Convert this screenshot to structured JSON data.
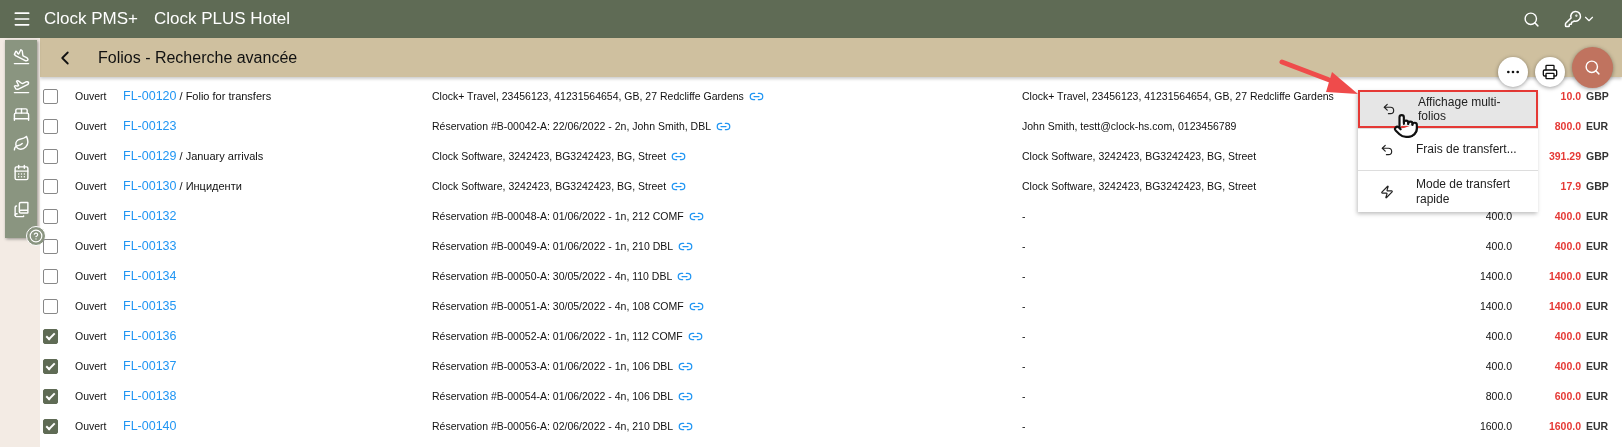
{
  "app_bar": {
    "app_name": "Clock PMS+",
    "hotel_name": "Clock PLUS Hotel"
  },
  "page_header": {
    "title": "Folios - Recherche avancée"
  },
  "rows": [
    {
      "checked": false,
      "status": "Ouvert",
      "folio": "FL-00120",
      "note": "/ Folio for transfers",
      "description": "Clock+ Travel, 23456123, 41231564654, GB, 27 Redcliffe Gardens",
      "client": "Clock+ Travel, 23456123, 41231564654, GB, 27 Redcliffe Gardens",
      "balance": "10.0",
      "currency": "GBP"
    },
    {
      "checked": false,
      "status": "Ouvert",
      "folio": "FL-00123",
      "description": "Réservation #B-00042-A: 22/06/2022 - 2n, John Smith, DBL",
      "client": "John Smith, testt@clock-hs.com, 0123456789",
      "balance": "800.0",
      "currency": "EUR"
    },
    {
      "checked": false,
      "status": "Ouvert",
      "folio": "FL-00129",
      "note": "/ January arrivals",
      "description": "Clock Software, 3242423, BG3242423, BG, Street",
      "client": "Clock Software, 3242423, BG3242423, BG, Street",
      "balance": "391.29",
      "currency": "GBP"
    },
    {
      "checked": false,
      "status": "Ouvert",
      "folio": "FL-00130",
      "note": "/ Инциденти",
      "description": "Clock Software, 3242423, BG3242423, BG, Street",
      "client": "Clock Software, 3242423, BG3242423, BG, Street",
      "balance": "17.9",
      "currency": "GBP"
    },
    {
      "checked": false,
      "status": "Ouvert",
      "folio": "FL-00132",
      "description": "Réservation #B-00048-A: 01/06/2022 - 1n, 212 COMF",
      "client": "-",
      "amount": "400.0",
      "balance": "400.0",
      "currency": "EUR"
    },
    {
      "checked": false,
      "status": "Ouvert",
      "folio": "FL-00133",
      "description": "Réservation #B-00049-A: 01/06/2022 - 1n, 210 DBL",
      "client": "-",
      "amount": "400.0",
      "balance": "400.0",
      "currency": "EUR"
    },
    {
      "checked": false,
      "status": "Ouvert",
      "folio": "FL-00134",
      "description": "Réservation #B-00050-A: 30/05/2022 - 4n, 110 DBL",
      "client": "-",
      "amount": "1400.0",
      "balance": "1400.0",
      "currency": "EUR"
    },
    {
      "checked": false,
      "status": "Ouvert",
      "folio": "FL-00135",
      "description": "Réservation #B-00051-A: 30/05/2022 - 4n, 108 COMF",
      "client": "-",
      "amount": "1400.0",
      "balance": "1400.0",
      "currency": "EUR"
    },
    {
      "checked": true,
      "status": "Ouvert",
      "folio": "FL-00136",
      "description": "Réservation #B-00052-A: 01/06/2022 - 1n, 112 COMF",
      "client": "-",
      "amount": "400.0",
      "balance": "400.0",
      "currency": "EUR"
    },
    {
      "checked": true,
      "status": "Ouvert",
      "folio": "FL-00137",
      "description": "Réservation #B-00053-A: 01/06/2022 - 1n, 106 DBL",
      "client": "-",
      "amount": "400.0",
      "balance": "400.0",
      "currency": "EUR"
    },
    {
      "checked": true,
      "status": "Ouvert",
      "folio": "FL-00138",
      "description": "Réservation #B-00054-A: 01/06/2022 - 4n, 106 DBL",
      "client": "-",
      "amount": "800.0",
      "balance": "600.0",
      "currency": "EUR"
    },
    {
      "checked": true,
      "status": "Ouvert",
      "folio": "FL-00140",
      "description": "Réservation #B-00056-A: 02/06/2022 - 4n, 210 DBL",
      "client": "-",
      "amount": "1600.0",
      "balance": "1600.0",
      "currency": "EUR"
    }
  ],
  "menu": [
    {
      "kind": "undo",
      "label": "Affichage multi-folios",
      "selected": true
    },
    {
      "kind": "undo",
      "label": "Frais de transfert...",
      "selected": false
    },
    {
      "kind": "bolt",
      "label": "Mode de transfert rapide",
      "selected": false
    }
  ]
}
